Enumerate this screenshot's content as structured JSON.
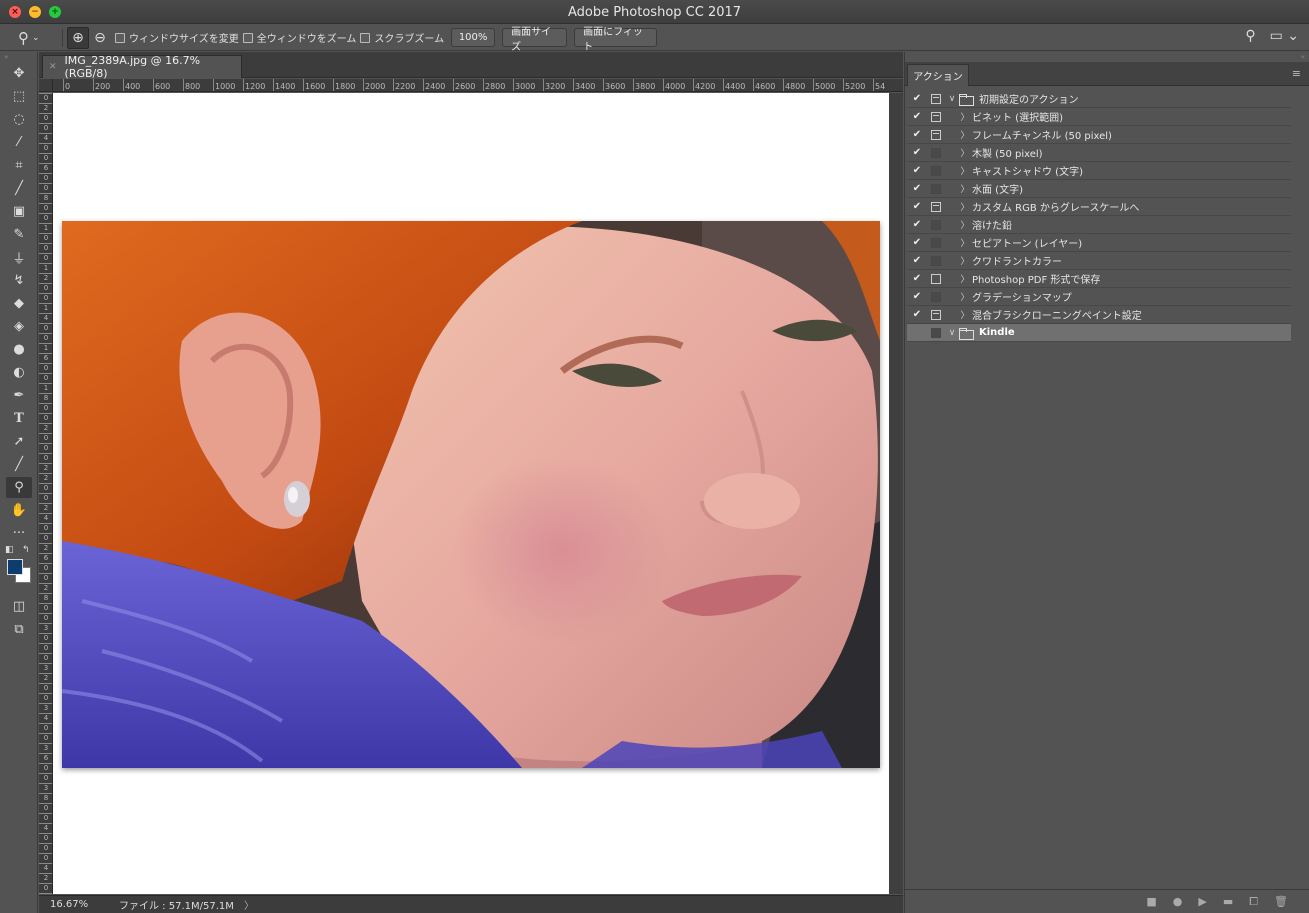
{
  "window": {
    "title": "Adobe Photoshop CC 2017"
  },
  "options_bar": {
    "tool_icon": "zoom-icon",
    "zoom_in_icon": "zoom-in-icon",
    "zoom_out_icon": "zoom-out-icon",
    "resize_windows": "ウィンドウサイズを変更",
    "zoom_all_windows": "全ウィンドウをズーム",
    "scrubby_zoom": "スクラブズーム",
    "percent_button": "100%",
    "fill_screen_button": "画面サイズ",
    "fit_screen_button": "画面にフィット"
  },
  "document": {
    "tab_title": "IMG_2389A.jpg @ 16.7% (RGB/8)",
    "ruler_h": [
      "0",
      "200",
      "400",
      "600",
      "800",
      "1000",
      "1200",
      "1400",
      "1600",
      "1800",
      "2000",
      "2200",
      "2400",
      "2600",
      "2800",
      "3000",
      "3200",
      "3400",
      "3600",
      "3800",
      "4000",
      "4200",
      "4400",
      "4600",
      "4800",
      "5000",
      "5200",
      "54"
    ],
    "ruler_v": [
      "0",
      "2",
      "0",
      "0",
      "4",
      "0",
      "0",
      "6",
      "0",
      "0",
      "8",
      "0",
      "0",
      "1",
      "0",
      "0",
      "0",
      "1",
      "2",
      "0",
      "0",
      "1",
      "4",
      "0",
      "0",
      "1",
      "6",
      "0",
      "0",
      "1",
      "8",
      "0",
      "0",
      "2",
      "0",
      "0",
      "0",
      "2",
      "2",
      "0",
      "0",
      "2",
      "4",
      "0",
      "0",
      "2",
      "6",
      "0",
      "0",
      "2",
      "8",
      "0",
      "0",
      "3",
      "0",
      "0",
      "0",
      "3",
      "2",
      "0",
      "0",
      "3",
      "4",
      "0",
      "0",
      "3",
      "6",
      "0",
      "0",
      "3",
      "8",
      "0",
      "0",
      "4",
      "0",
      "0",
      "0",
      "4",
      "2",
      "0",
      "0",
      "4",
      "4",
      "0",
      "0"
    ],
    "status_zoom": "16.67%",
    "status_file": "ファイル : 57.1M/57.1M",
    "status_arrow": "〉"
  },
  "colors": {
    "foreground": "#0d3c6e",
    "background": "#ffffff"
  },
  "actions_panel": {
    "tab": "アクション",
    "rows": [
      {
        "label": "初期設定のアクション",
        "checked": true,
        "dialog": "on",
        "twisty": "∨",
        "type": "set"
      },
      {
        "label": "ビネット (選択範囲)",
        "checked": true,
        "dialog": "on",
        "twisty": "〉",
        "type": "action"
      },
      {
        "label": "フレームチャンネル (50 pixel)",
        "checked": true,
        "dialog": "on",
        "twisty": "〉",
        "type": "action"
      },
      {
        "label": "木製 (50 pixel)",
        "checked": true,
        "dialog": "off",
        "twisty": "〉",
        "type": "action"
      },
      {
        "label": "キャストシャドウ (文字)",
        "checked": true,
        "dialog": "off",
        "twisty": "〉",
        "type": "action"
      },
      {
        "label": "水面 (文字)",
        "checked": true,
        "dialog": "off",
        "twisty": "〉",
        "type": "action"
      },
      {
        "label": "カスタム RGB からグレースケールへ",
        "checked": true,
        "dialog": "on",
        "twisty": "〉",
        "type": "action"
      },
      {
        "label": "溶けた鉛",
        "checked": true,
        "dialog": "off",
        "twisty": "〉",
        "type": "action"
      },
      {
        "label": "セピアトーン (レイヤー)",
        "checked": true,
        "dialog": "off",
        "twisty": "〉",
        "type": "action"
      },
      {
        "label": "クワドラントカラー",
        "checked": true,
        "dialog": "off",
        "twisty": "〉",
        "type": "action"
      },
      {
        "label": "Photoshop PDF 形式で保存",
        "checked": true,
        "dialog": "plain",
        "twisty": "〉",
        "type": "action"
      },
      {
        "label": "グラデーションマップ",
        "checked": true,
        "dialog": "off",
        "twisty": "〉",
        "type": "action"
      },
      {
        "label": "混合ブラシクローニングペイント設定",
        "checked": true,
        "dialog": "on",
        "twisty": "〉",
        "type": "action"
      },
      {
        "label": "Kindle",
        "checked": false,
        "dialog": "off",
        "twisty": "∨",
        "type": "set",
        "selected": true
      }
    ],
    "footer_icons": [
      "stop-icon",
      "record-icon",
      "play-icon",
      "new-set-icon",
      "new-action-icon",
      "trash-icon"
    ]
  }
}
